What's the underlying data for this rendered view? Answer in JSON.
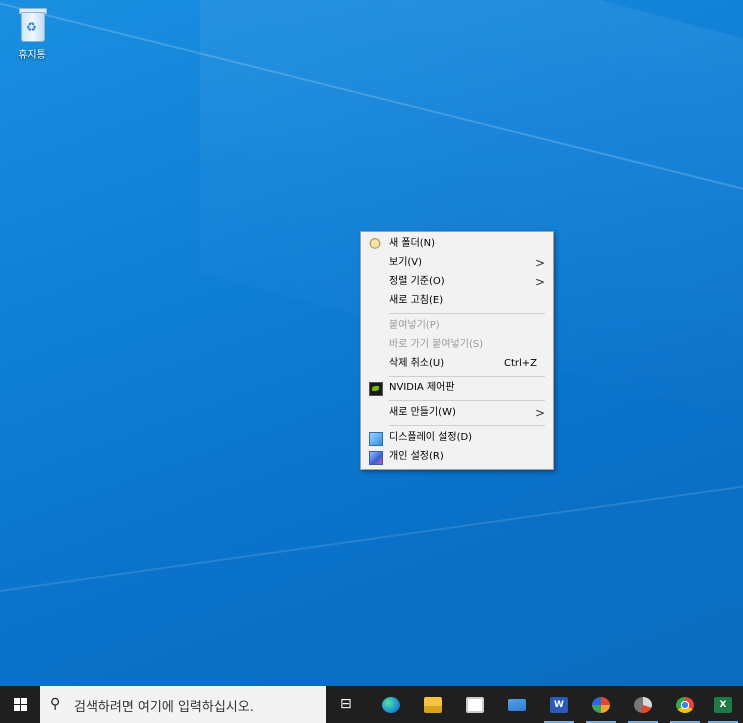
{
  "desktop": {
    "recycle_bin_label": "휴지통"
  },
  "context_menu": {
    "items": [
      {
        "label": "새 폴더(N)",
        "icon": "folder-icon",
        "enabled": true
      },
      {
        "label": "보기(V)",
        "submenu": true,
        "enabled": true
      },
      {
        "label": "정렬 기준(O)",
        "submenu": true,
        "enabled": true
      },
      {
        "label": "새로 고침(E)",
        "enabled": true
      },
      {
        "label": "붙여넣기(P)",
        "enabled": false
      },
      {
        "label": "바로 가기 붙여넣기(S)",
        "enabled": false
      },
      {
        "label": "삭제 취소(U)",
        "shortcut": "Ctrl+Z",
        "enabled": true
      },
      {
        "label": "NVIDIA 제어판",
        "icon": "nvidia-icon",
        "enabled": true
      },
      {
        "label": "새로 만들기(W)",
        "submenu": true,
        "enabled": true
      },
      {
        "label": "디스플레이 설정(D)",
        "icon": "display-settings-icon",
        "enabled": true
      },
      {
        "label": "개인 설정(R)",
        "icon": "personalize-icon",
        "enabled": true
      }
    ],
    "arrow_glyph": ">"
  },
  "taskbar": {
    "search_placeholder": "검색하려면 여기에 입력하십시오.",
    "task_view_glyph": "⊟",
    "apps": [
      {
        "name": "edge-icon",
        "color": "#1e8fd6"
      },
      {
        "name": "file-explorer-icon",
        "color": "#f5c242"
      },
      {
        "name": "store-icon",
        "color": "#ffffff"
      },
      {
        "name": "mail-icon",
        "color": "#2b7cd3"
      },
      {
        "name": "word-icon",
        "color": "#2b5bb8"
      },
      {
        "name": "circle-app-icon",
        "color": "#e04a2f"
      },
      {
        "name": "photo-app-icon",
        "color": "#d9d9d9"
      },
      {
        "name": "chrome-icon",
        "color": "#e8453c"
      },
      {
        "name": "excel-icon",
        "color": "#1f7a45"
      }
    ]
  }
}
